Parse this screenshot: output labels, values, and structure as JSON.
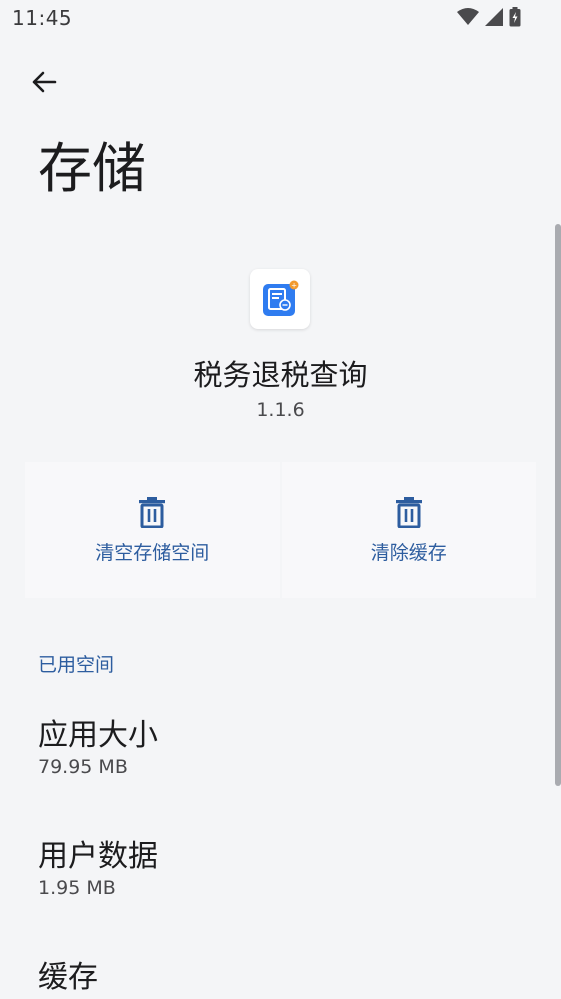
{
  "status_bar": {
    "time": "11:45"
  },
  "page": {
    "title": "存储"
  },
  "app": {
    "name": "税务退税查询",
    "version": "1.1.6"
  },
  "actions": {
    "clear_storage": "清空存储空间",
    "clear_cache": "清除缓存"
  },
  "section": {
    "used_space": "已用空间"
  },
  "items": [
    {
      "title": "应用大小",
      "value": "79.95 MB"
    },
    {
      "title": "用户数据",
      "value": "1.95 MB"
    },
    {
      "title": "缓存",
      "value": ""
    }
  ],
  "colors": {
    "accent": "#2d5d9f",
    "background": "#f4f5f7",
    "app_icon_blue": "#2f7cf0"
  }
}
